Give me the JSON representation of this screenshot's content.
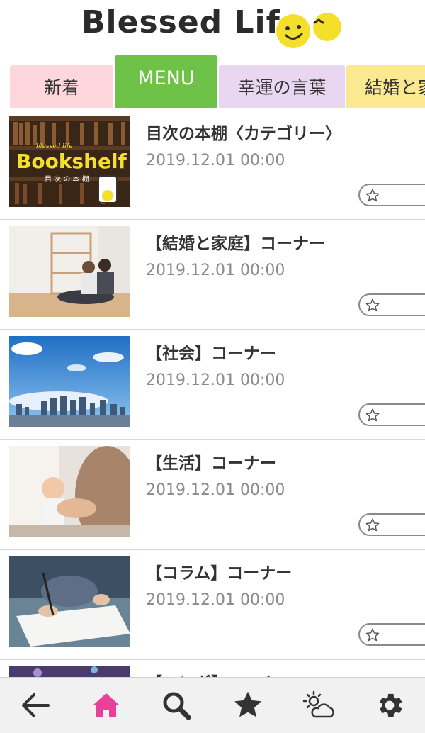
{
  "header": {
    "logo_text": "Blessed Life"
  },
  "tabs": [
    {
      "label": "新着"
    },
    {
      "label": "MENU",
      "active": true
    },
    {
      "label": "幸運の言葉"
    },
    {
      "label": "結婚と家"
    }
  ],
  "list": [
    {
      "title": "目次の本棚〈カテゴリー〉",
      "date": "2019.12.01 00:00",
      "thumb": "bookshelf-image",
      "thumb_title": "Bookshelf",
      "thumb_caption": "目 次 の 本 棚",
      "thumb_script": "blessed life"
    },
    {
      "title": "【結婚と家庭】コーナー",
      "date": "2019.12.01 00:00",
      "thumb": "family-photo"
    },
    {
      "title": "【社会】コーナー",
      "date": "2019.12.01 00:00",
      "thumb": "city-skyline-photo"
    },
    {
      "title": "【生活】コーナー",
      "date": "2019.12.01 00:00",
      "thumb": "parent-child-photo"
    },
    {
      "title": "【コラム】コーナー",
      "date": "2019.12.01 00:00",
      "thumb": "writing-hand-photo"
    },
    {
      "title": "【マンガ】コーナー",
      "date": "",
      "thumb": "manga-image"
    }
  ],
  "bottom_nav": [
    {
      "icon": "back-arrow-icon"
    },
    {
      "icon": "home-icon",
      "active": true
    },
    {
      "icon": "search-icon"
    },
    {
      "icon": "star-icon"
    },
    {
      "icon": "weather-icon"
    },
    {
      "icon": "gear-icon"
    }
  ],
  "colors": {
    "accent_green": "#6dc247",
    "home_pink": "#e8419a",
    "tab_pink": "#fdd7dc",
    "tab_purple": "#e9d7f2",
    "tab_yellow": "#fbe992"
  }
}
